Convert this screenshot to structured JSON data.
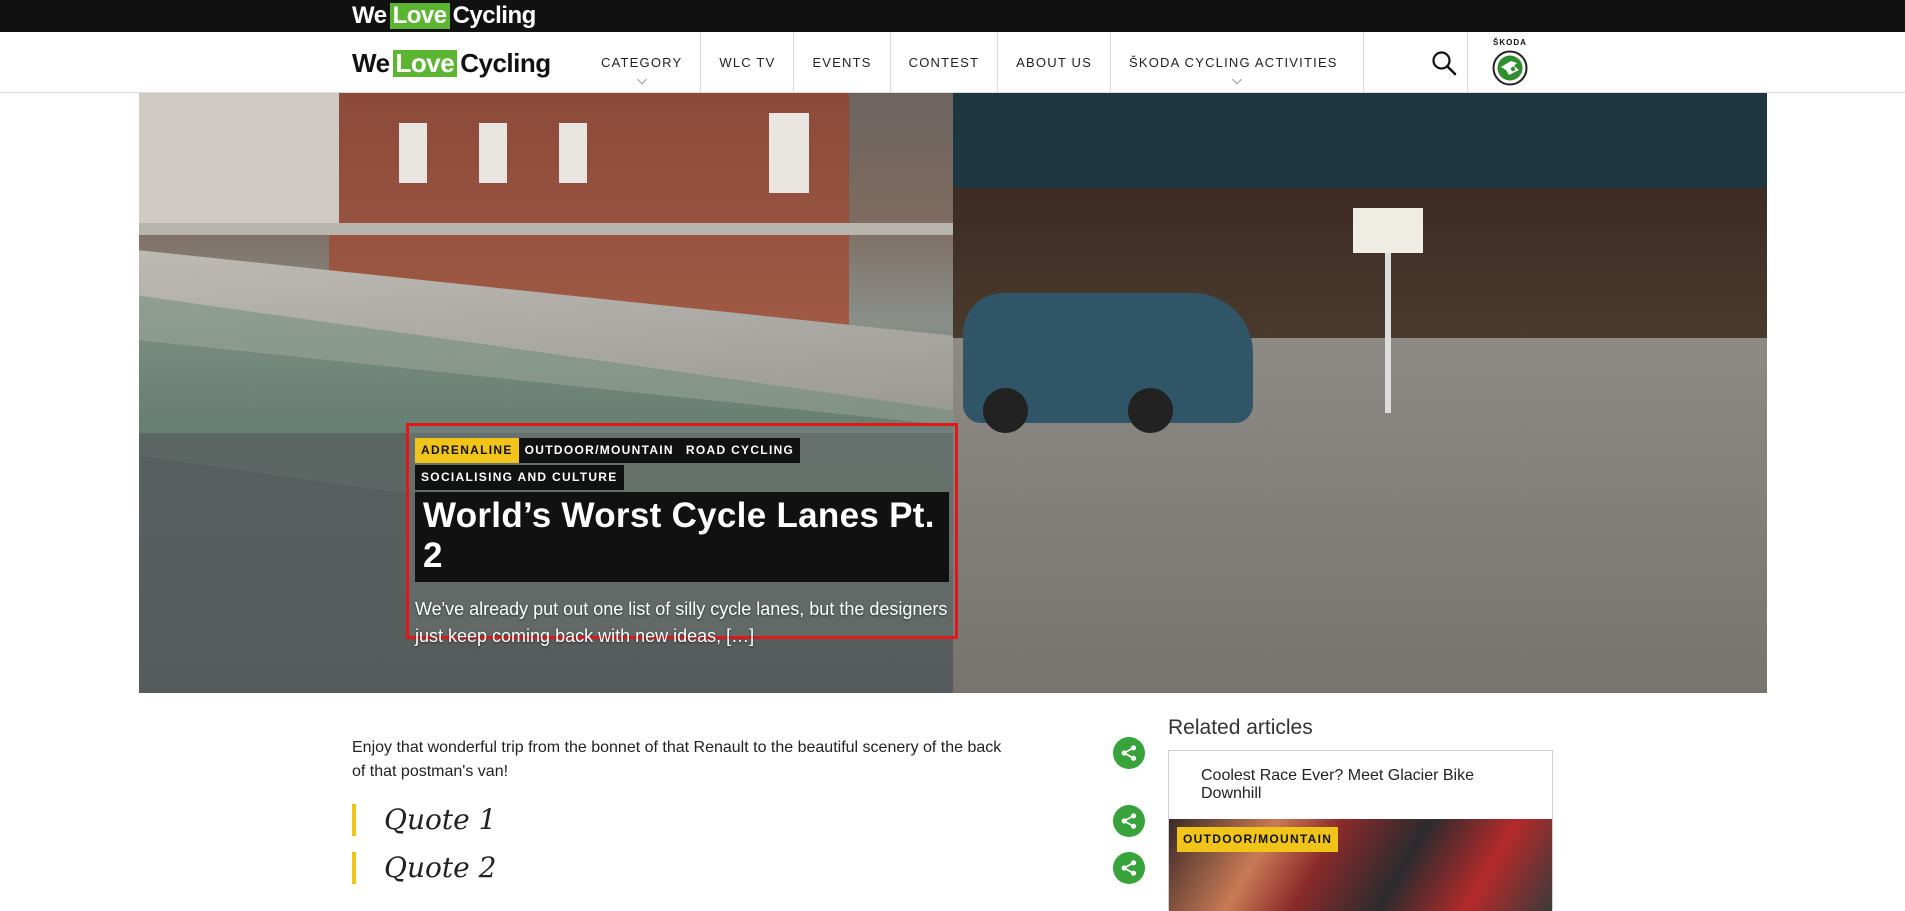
{
  "brand": {
    "word1": "We",
    "love": "Love",
    "word2": "Cycling"
  },
  "nav": {
    "items": [
      {
        "label": "CATEGORY",
        "has_dropdown": true
      },
      {
        "label": "WLC TV",
        "has_dropdown": false
      },
      {
        "label": "EVENTS",
        "has_dropdown": false
      },
      {
        "label": "CONTEST",
        "has_dropdown": false
      },
      {
        "label": "ABOUT US",
        "has_dropdown": false
      },
      {
        "label": "ŠKODA CYCLING ACTIVITIES",
        "has_dropdown": true
      }
    ],
    "search_icon": "search-icon",
    "partner_label": "ŠKODA"
  },
  "hero": {
    "tags_row1": [
      "ADRENALINE",
      "OUTDOOR/MOUNTAIN",
      "ROAD CYCLING"
    ],
    "tags_row2": [
      "SOCIALISING AND CULTURE"
    ],
    "title": "World’s Worst Cycle Lanes Pt. 2",
    "excerpt": "We've already put out one list of silly cycle lanes, but the designers just keep coming back with new ideas, […]",
    "highlight_color": "#e01818"
  },
  "article": {
    "intro": "Enjoy that wonderful trip from the bonnet of that Renault to the beautiful scenery of the back of that postman's van!",
    "quotes": [
      "Quote 1",
      "Quote 2"
    ]
  },
  "share": {
    "icon": "share-icon",
    "color": "#37a33a"
  },
  "related": {
    "heading": "Related articles",
    "items": [
      {
        "title": "Coolest Race Ever? Meet Glacier Bike Downhill",
        "tag": "OUTDOOR/MOUNTAIN"
      }
    ]
  },
  "colors": {
    "accent_yellow": "#f0c419",
    "brand_green": "#5cb531",
    "topbar": "#111111"
  }
}
